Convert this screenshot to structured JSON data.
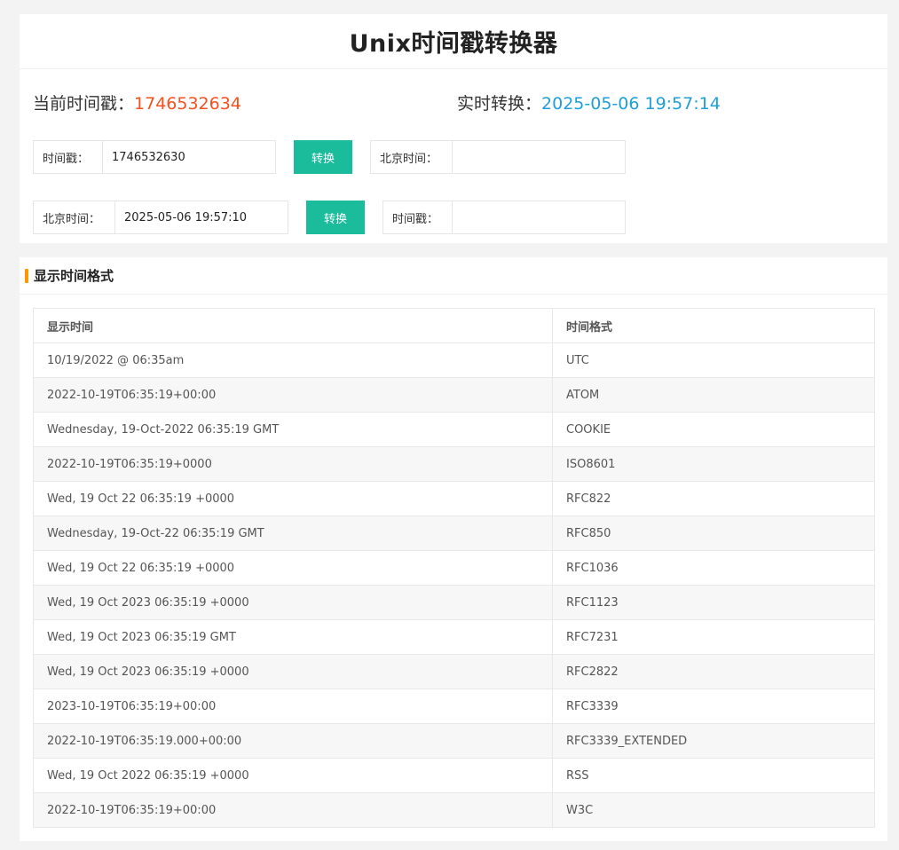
{
  "page": {
    "title": "Unix时间戳转换器"
  },
  "status": {
    "current_label": "当前时间戳：",
    "current_value": "1746532634",
    "realtime_label": "实时转换：",
    "realtime_value": "2025-05-06 19:57:14"
  },
  "colors": {
    "accent_green": "#1bbc9b",
    "timestamp_orange": "#f4511e",
    "datetime_blue": "#1e9fdc",
    "section_marker_orange": "#ff9800"
  },
  "converter1": {
    "input_label": "时间戳：",
    "input_value": "1746532630",
    "button_label": "转换",
    "output_label": "北京时间：",
    "output_value": ""
  },
  "converter2": {
    "input_label": "北京时间：",
    "input_value": "2025-05-06 19:57:10",
    "button_label": "转换",
    "output_label": "时间戳：",
    "output_value": ""
  },
  "formats": {
    "section_title": "显示时间格式",
    "columns": [
      "显示时间",
      "时间格式"
    ],
    "rows": [
      [
        "10/19/2022 @ 06:35am",
        "UTC"
      ],
      [
        "2022-10-19T06:35:19+00:00",
        "ATOM"
      ],
      [
        "Wednesday, 19-Oct-2022 06:35:19 GMT",
        "COOKIE"
      ],
      [
        "2022-10-19T06:35:19+0000",
        "ISO8601"
      ],
      [
        "Wed, 19 Oct 22 06:35:19 +0000",
        "RFC822"
      ],
      [
        "Wednesday, 19-Oct-22 06:35:19 GMT",
        "RFC850"
      ],
      [
        "Wed, 19 Oct 22 06:35:19 +0000",
        "RFC1036"
      ],
      [
        "Wed, 19 Oct 2023 06:35:19 +0000",
        "RFC1123"
      ],
      [
        "Wed, 19 Oct 2023 06:35:19 GMT",
        "RFC7231"
      ],
      [
        "Wed, 19 Oct 2023 06:35:19 +0000",
        "RFC2822"
      ],
      [
        "2023-10-19T06:35:19+00:00",
        "RFC3339"
      ],
      [
        "2022-10-19T06:35:19.000+00:00",
        "RFC3339_EXTENDED"
      ],
      [
        "Wed, 19 Oct 2022 06:35:19 +0000",
        "RSS"
      ],
      [
        "2022-10-19T06:35:19+00:00",
        "W3C"
      ]
    ]
  }
}
